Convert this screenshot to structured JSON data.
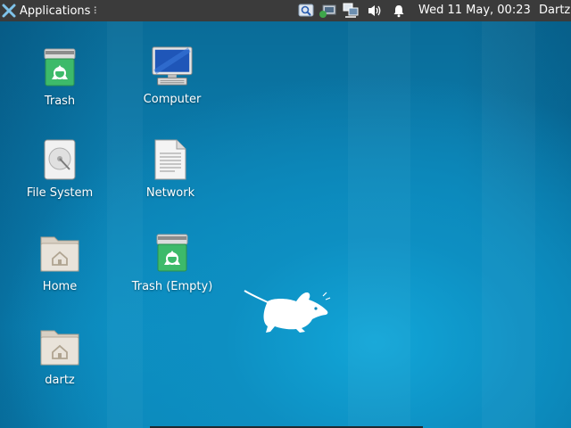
{
  "panel": {
    "applications_label": "Applications",
    "clock": "Wed 11 May, 00:23",
    "user": "Dartz",
    "tray_icons": [
      "search-icon",
      "network-tray-icon",
      "display-network-icon",
      "volume-icon",
      "notification-bell-icon"
    ]
  },
  "desktop": {
    "icons": [
      {
        "id": "trash",
        "label": "Trash",
        "icon": "trash-icon"
      },
      {
        "id": "computer",
        "label": "Computer",
        "icon": "computer-icon"
      },
      {
        "id": "file-system",
        "label": "File System",
        "icon": "drive-icon"
      },
      {
        "id": "network",
        "label": "Network",
        "icon": "document-icon"
      },
      {
        "id": "home",
        "label": "Home",
        "icon": "home-folder-icon"
      },
      {
        "id": "trash-empty",
        "label": "Trash (Empty)",
        "icon": "trash-icon"
      },
      {
        "id": "dartz",
        "label": "dartz",
        "icon": "home-folder-icon"
      }
    ]
  },
  "colors": {
    "panel_bg": "#3b3b3b",
    "desktop_bg": "#0b86b8",
    "trash_green": "#3dba6a"
  }
}
